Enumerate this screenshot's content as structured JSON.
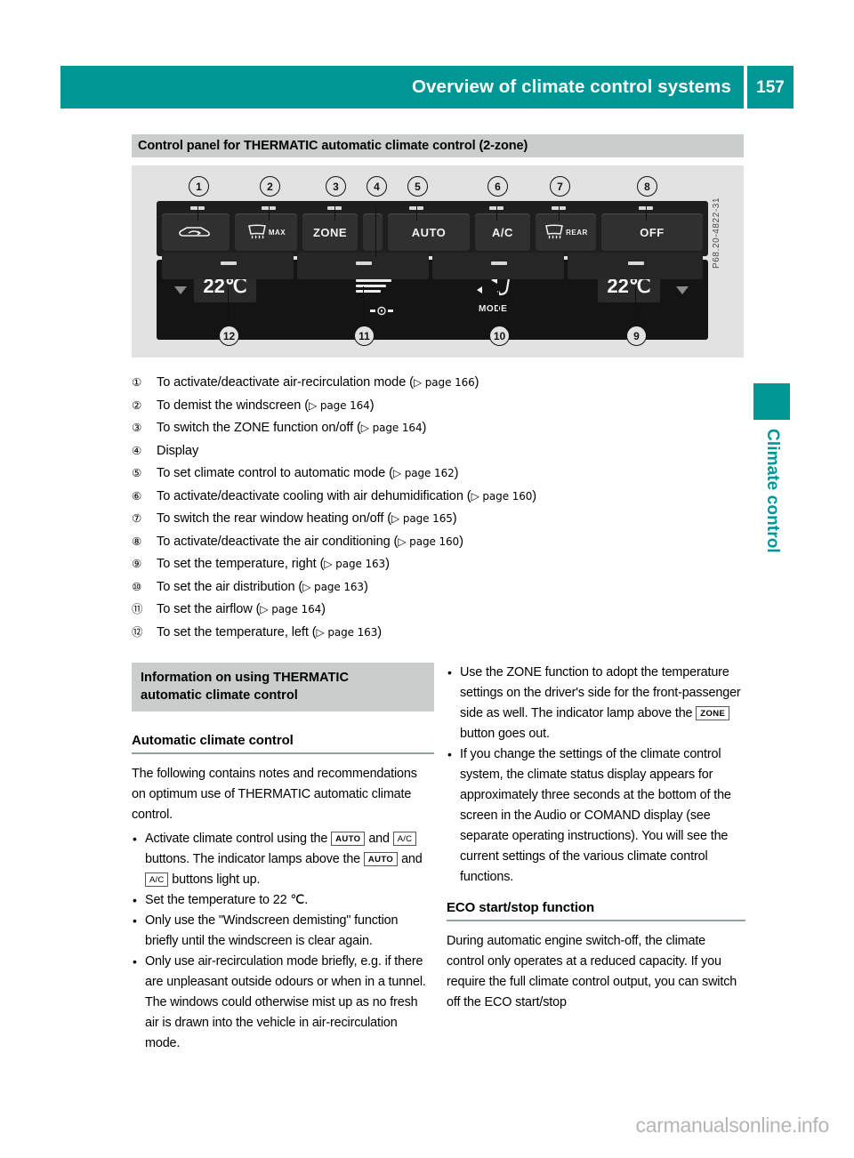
{
  "colors": {
    "accent_teal": "#009696",
    "caption_grey": "#c9cecd",
    "figure_grey": "#e2e2e2",
    "rule_grey": "#8fa3a3",
    "watermark_grey": "#b5b5b5"
  },
  "header": {
    "title": "Overview of climate control systems",
    "page_number": "157"
  },
  "figure": {
    "caption": "Control panel for THERMATIC automatic climate control (2-zone)",
    "image_code": "P68.20-4822-31",
    "panel": {
      "buttons": [
        {
          "id": "recirc",
          "label": ""
        },
        {
          "id": "defrost-max",
          "label": "MAX"
        },
        {
          "id": "zone",
          "label": "ZONE"
        },
        {
          "id": "auto",
          "label": "AUTO"
        },
        {
          "id": "ac",
          "label": "A/C"
        },
        {
          "id": "rear-defrost",
          "label": "REAR"
        },
        {
          "id": "off",
          "label": "OFF"
        }
      ],
      "temperature_left": "22℃",
      "temperature_right": "22℃",
      "mode_label": "MODE",
      "callouts": [
        "1",
        "2",
        "3",
        "4",
        "5",
        "6",
        "7",
        "8",
        "9",
        "10",
        "11",
        "12"
      ]
    }
  },
  "legend": [
    {
      "marker": "①",
      "text": "To activate/deactivate air-recirculation mode (",
      "ref": "▷ page 166",
      "close": ")"
    },
    {
      "marker": "②",
      "text": "To demist the windscreen (",
      "ref": "▷ page 164",
      "close": ")"
    },
    {
      "marker": "③",
      "text": "To switch the ZONE function on/off (",
      "ref": "▷ page 164",
      "close": ")"
    },
    {
      "marker": "④",
      "text": "Display",
      "ref": "",
      "close": ""
    },
    {
      "marker": "⑤",
      "text": "To set climate control to automatic mode (",
      "ref": "▷ page 162",
      "close": ")"
    },
    {
      "marker": "⑥",
      "text": "To activate/deactivate cooling with air dehumidification (",
      "ref": "▷ page 160",
      "close": ")"
    },
    {
      "marker": "⑦",
      "text": "To switch the rear window heating on/off (",
      "ref": "▷ page 165",
      "close": ")"
    },
    {
      "marker": "⑧",
      "text": "To activate/deactivate the air conditioning (",
      "ref": "▷ page 160",
      "close": ")"
    },
    {
      "marker": "⑨",
      "text": "To set the temperature, right (",
      "ref": "▷ page 163",
      "close": ")"
    },
    {
      "marker": "⑩",
      "text": "To set the air distribution (",
      "ref": "▷ page 163",
      "close": ")"
    },
    {
      "marker": "⑪",
      "text": "To set the airflow (",
      "ref": "▷ page 164",
      "close": ")"
    },
    {
      "marker": "⑫",
      "text": "To set the temperature, left (",
      "ref": "▷ page 163",
      "close": ")"
    }
  ],
  "left_column": {
    "info_box_line1": "Information on using THERMATIC",
    "info_box_line2": "automatic climate control",
    "heading": "Automatic climate control",
    "intro": "The following contains notes and recommendations on optimum use of THERMATIC automatic climate control.",
    "bullets": [
      {
        "part1": "Activate climate control using the ",
        "key1": "AUTO",
        "part2": " and ",
        "key2": "A/C",
        "part3": " buttons. The indicator lamps above the ",
        "key3": "AUTO",
        "part4": " and ",
        "key4": "A/C",
        "part5": " buttons light up."
      },
      {
        "part1": "Set the temperature to 22 ℃."
      },
      {
        "part1": "Only use the \"Windscreen demisting\" function briefly until the windscreen is clear again."
      },
      {
        "part1": "Only use air-recirculation mode briefly, e.g. if there are unpleasant outside odours or when in a tunnel. The windows could otherwise mist up as no fresh air is drawn into the vehicle in air-recirculation mode."
      }
    ]
  },
  "right_column": {
    "bullets": [
      {
        "part1": "Use the ZONE function to adopt the temperature settings on the driver's side for the front-passenger side as well. The indicator lamp above the ",
        "key1": "ZONE",
        "part2": " button goes out."
      },
      {
        "part1": "If you change the settings of the climate control system, the climate status display appears for approximately three seconds at the bottom of the screen in the Audio or COMAND display (see separate operating instructions). You will see the current settings of the various climate control functions."
      }
    ],
    "heading": "ECO start/stop function",
    "paragraph": "During automatic engine switch-off, the climate control only operates at a reduced capacity. If you require the full climate control output, you can switch off the ECO start/stop"
  },
  "side_tab": {
    "label": "Climate control"
  },
  "footer": {
    "watermark": "carmanualsonline.info"
  }
}
